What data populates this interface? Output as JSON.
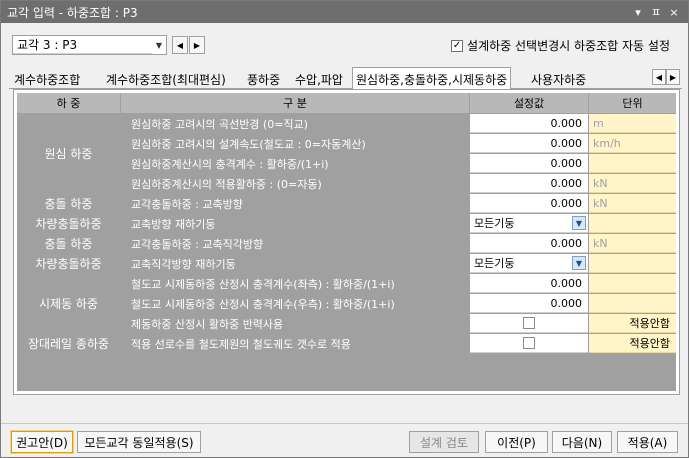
{
  "window": {
    "title": "교각 입력 - 하중조합 : P3",
    "controls": [
      "▾",
      "ㅍ",
      "×"
    ]
  },
  "topbar": {
    "pier_select": "교각 3 : P3",
    "auto_setting_checked": true,
    "auto_setting_label": "설계하중 선택변경시 하중조합 자동 설정"
  },
  "tabs": [
    {
      "label": "계수하중조합"
    },
    {
      "label": "계수하중조합(최대편심)"
    },
    {
      "label": "풍하중"
    },
    {
      "label": "수압,파압"
    },
    {
      "label": "원심하중,충돌하중,시제동하중"
    },
    {
      "label": "사용자하중"
    }
  ],
  "table": {
    "headers": [
      "하 중",
      "구 분",
      "설정값",
      "단위"
    ],
    "groups": [
      "원심 하중",
      "충돌 하중",
      "차량충돌하중",
      "충돌 하중",
      "차량충돌하중",
      "시제동 하중",
      "장대레일 종하중"
    ],
    "rows": [
      {
        "desc": "원심하중 고려시의 곡선반경 (0=직교)",
        "value": "0.000",
        "unit": "m"
      },
      {
        "desc": "원심하중 고려시의 설계속도(철도교 : 0=자동계산)",
        "value": "0.000",
        "unit": "km/h"
      },
      {
        "desc": "원심하중계산시의 충격계수 : 활하중/(1+i)",
        "value": "0.000",
        "unit": ""
      },
      {
        "desc": "원심하중계산시의 적용활하중 : (0=자동)",
        "value": "0.000",
        "unit": "kN"
      },
      {
        "desc": "교각충돌하중 : 교축방향",
        "value": "0.000",
        "unit": "kN"
      },
      {
        "desc": "교축방향  재하기둥",
        "value": "모든기둥",
        "unit": ""
      },
      {
        "desc": "교각충돌하중 : 교축직각방향",
        "value": "0.000",
        "unit": "kN"
      },
      {
        "desc": "교축직각방향  재하기둥",
        "value": "모든기둥",
        "unit": ""
      },
      {
        "desc": "철도교 시제동하중 산정시 충격계수(좌측) : 활하중/(1+i)",
        "value": "0.000",
        "unit": ""
      },
      {
        "desc": "철도교 시제동하중 산정시 충격계수(우측) : 활하중/(1+i)",
        "value": "0.000",
        "unit": ""
      },
      {
        "desc": "제동하중 산정시 활하중 반력사용",
        "value": "",
        "unit": "적용안함"
      },
      {
        "desc": "적용 선로수를 철도제원의 철도궤도 갯수로 적용",
        "value": "",
        "unit": "적용안함"
      }
    ]
  },
  "bottombar": {
    "recommend": "권고안(D)",
    "apply_all": "모든교각 동일적용(S)",
    "design_check": "설계 검토",
    "prev": "이전(P)",
    "next": "다음(N)",
    "apply": "적용(A)"
  }
}
